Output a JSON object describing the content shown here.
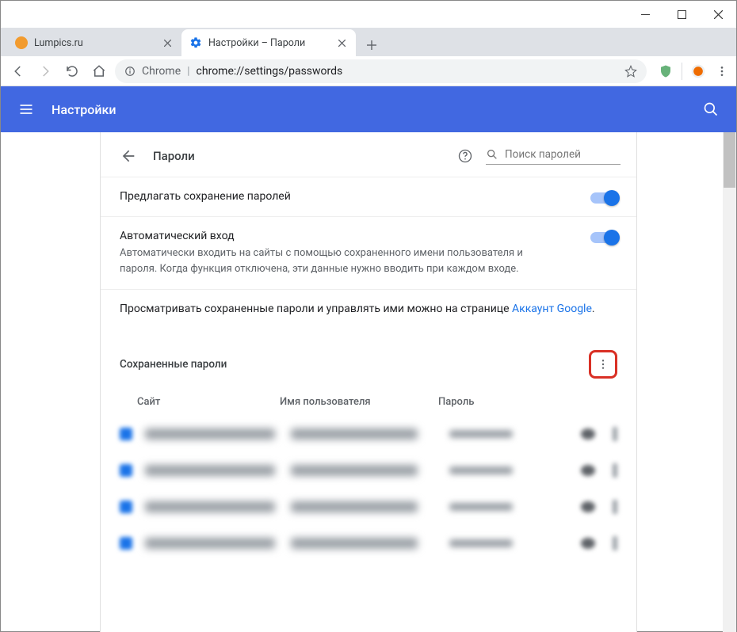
{
  "window": {
    "tabs": [
      {
        "title": "Lumpics.ru",
        "active": false
      },
      {
        "title": "Настройки – Пароли",
        "active": true
      }
    ]
  },
  "address_bar": {
    "protocol_label": "Chrome",
    "url_path": "chrome://settings/passwords"
  },
  "settings_header": {
    "title": "Настройки"
  },
  "page": {
    "title": "Пароли",
    "search_placeholder": "Поиск паролей",
    "offer_save": {
      "label": "Предлагать сохранение паролей",
      "enabled": true
    },
    "auto_signin": {
      "label": "Автоматический вход",
      "sub": "Автоматически входить на сайты с помощью сохраненного имени пользователя и пароля. Когда функция отключена, эти данные нужно вводить при каждом входе.",
      "enabled": true
    },
    "manage_text": "Просматривать сохраненные пароли и управлять ими можно на странице ",
    "manage_link": "Аккаунт Google",
    "saved_section": "Сохраненные пароли",
    "columns": {
      "site": "Сайт",
      "user": "Имя пользователя",
      "pass": "Пароль"
    },
    "rows_count": 4
  }
}
